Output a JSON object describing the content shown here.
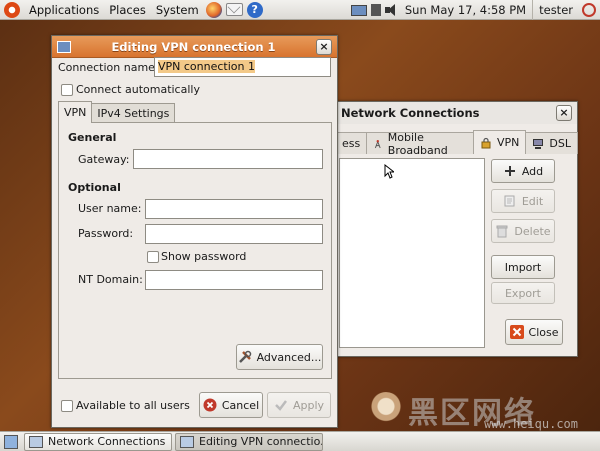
{
  "top_panel": {
    "menus": [
      "Applications",
      "Places",
      "System"
    ],
    "clock": "Sun May 17,  4:58 PM",
    "user": "tester"
  },
  "bottom_panel": {
    "tasks": [
      "Network Connections",
      "Editing VPN connectio..."
    ]
  },
  "network_connections": {
    "title": "Network Connections",
    "tabs": [
      "ess",
      "Mobile Broadband",
      "VPN",
      "DSL"
    ],
    "active_tab": "VPN",
    "buttons": {
      "add": "Add",
      "edit": "Edit",
      "delete": "Delete",
      "import": "Import",
      "export": "Export",
      "close": "Close"
    }
  },
  "editing_vpn": {
    "title": "Editing VPN connection 1",
    "connection_name_label": "Connection name:",
    "connection_name_value": "VPN connection 1",
    "connect_automatically": "Connect automatically",
    "tabs": [
      "VPN",
      "IPv4 Settings"
    ],
    "general_title": "General",
    "gateway_label": "Gateway:",
    "optional_title": "Optional",
    "username_label": "User name:",
    "password_label": "Password:",
    "show_password": "Show password",
    "nt_domain_label": "NT Domain:",
    "advanced_button": "Advanced...",
    "available_to_all_users": "Available to all users",
    "cancel_button": "Cancel",
    "apply_button": "Apply"
  },
  "colors": {
    "titlebar_active": "#d8732f",
    "desktop": "#6b3415",
    "selection": "#f3c988"
  },
  "watermark": {
    "text": "黑区网络",
    "sub": "www.heiqu.com"
  }
}
